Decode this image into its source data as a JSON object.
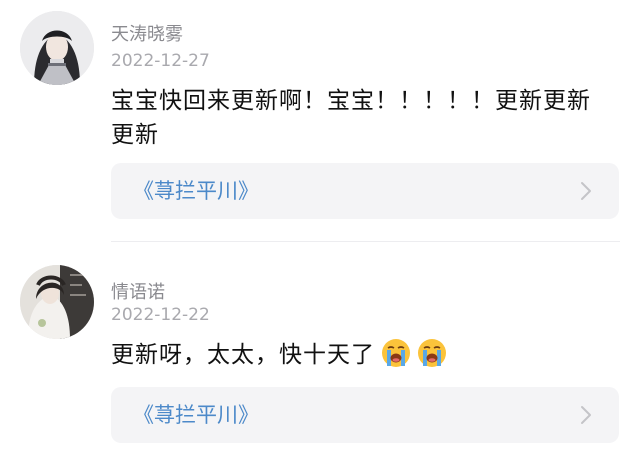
{
  "comments": [
    {
      "username": "天涛晓雾",
      "date": "2022-12-27",
      "text": "宝宝快回来更新啊！宝宝！！！！！更新更新更新",
      "emojis": [],
      "card_title": "《荨拦平川》",
      "avatar_icon": "avatar-dark-hair-icon"
    },
    {
      "username": "情语诺",
      "date": "2022-12-22",
      "text": "更新呀，太太，快十天了",
      "emojis": [
        "loudly-crying-face-emoji",
        "loudly-crying-face-emoji"
      ],
      "card_title": "《荨拦平川》",
      "avatar_icon": "avatar-ancient-style-icon"
    }
  ],
  "colors": {
    "link": "#4c89c9",
    "card_bg": "#f4f4f6",
    "meta_text": "#8a8a8f"
  }
}
